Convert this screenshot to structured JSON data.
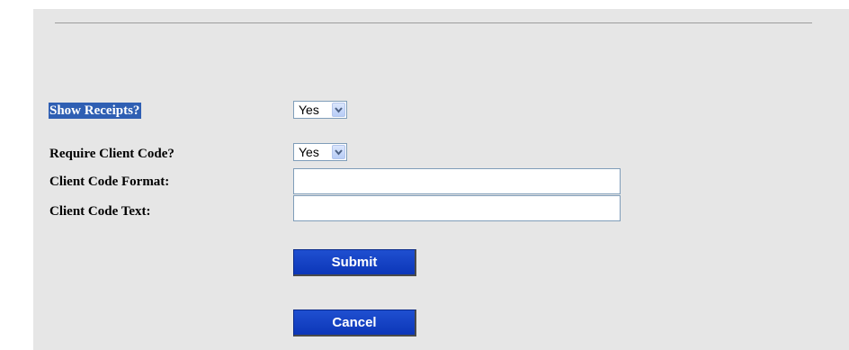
{
  "settings": {
    "show_receipts": {
      "label": "Show Receipts?",
      "value": "Yes"
    },
    "require_client_code": {
      "label": "Require Client Code?",
      "value": "Yes"
    },
    "client_code_format": {
      "label": "Client Code Format:",
      "value": ""
    },
    "client_code_text": {
      "label": "Client Code Text:",
      "value": ""
    }
  },
  "actions": {
    "submit_label": "Submit",
    "cancel_label": "Cancel"
  },
  "colors": {
    "background": "#e6e6e6",
    "button": "#0c36b8",
    "selection_highlight": "#2f5fb3"
  },
  "icons": {
    "dropdown": "chevron-down-icon"
  }
}
